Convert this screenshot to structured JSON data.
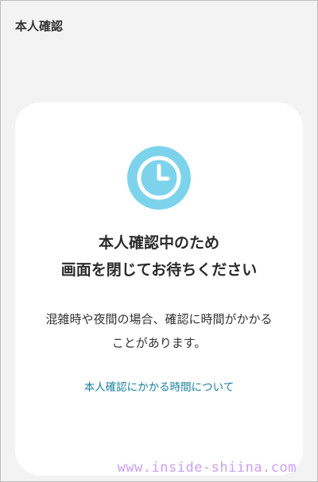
{
  "header": {
    "title": "本人確認"
  },
  "card": {
    "icon": "clock-icon",
    "heading_line1": "本人確認中のため",
    "heading_line2": "画面を閉じてお待ちください",
    "body_line1": "混雑時や夜間の場合、確認に時間がかかる",
    "body_line2": "ことがあります。",
    "link_label": "本人確認にかかる時間について"
  },
  "watermark": {
    "text": "www.inside-shiina.com"
  },
  "colors": {
    "background": "#f3f3f3",
    "card": "#ffffff",
    "icon_fill": "#7dd3ec",
    "link": "#1a7f9b",
    "watermark": "#c9a0ee"
  }
}
